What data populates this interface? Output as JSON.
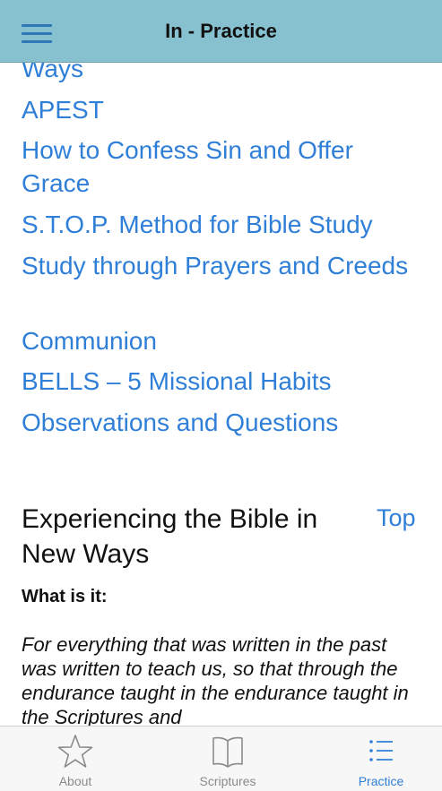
{
  "header": {
    "title": "In - Practice"
  },
  "toc": {
    "links": [
      "Ways",
      "APEST",
      "How to Confess Sin and Offer Grace",
      "S.T.O.P. Method for Bible Study",
      "Study through Prayers and Creeds",
      "Communion",
      "BELLS – 5 Missional Habits",
      "Observations and Questions"
    ]
  },
  "section": {
    "title": "Experiencing the Bible in New Ways",
    "top_link": "Top",
    "what_label": "What is it:",
    "quote": "For everything that was written in the past was written to teach us, so that through the endurance taught in the endurance taught in the Scriptures and"
  },
  "tabs": [
    {
      "label": "About",
      "icon": "star-icon",
      "active": false
    },
    {
      "label": "Scriptures",
      "icon": "book-icon",
      "active": false
    },
    {
      "label": "Practice",
      "icon": "list-icon",
      "active": true
    }
  ],
  "colors": {
    "header_bg": "#87c1cf",
    "link": "#2f7fd8",
    "menu_icon": "#2f78b7",
    "tab_inactive": "#8a8a8a",
    "tab_active": "#2f7fd8"
  }
}
